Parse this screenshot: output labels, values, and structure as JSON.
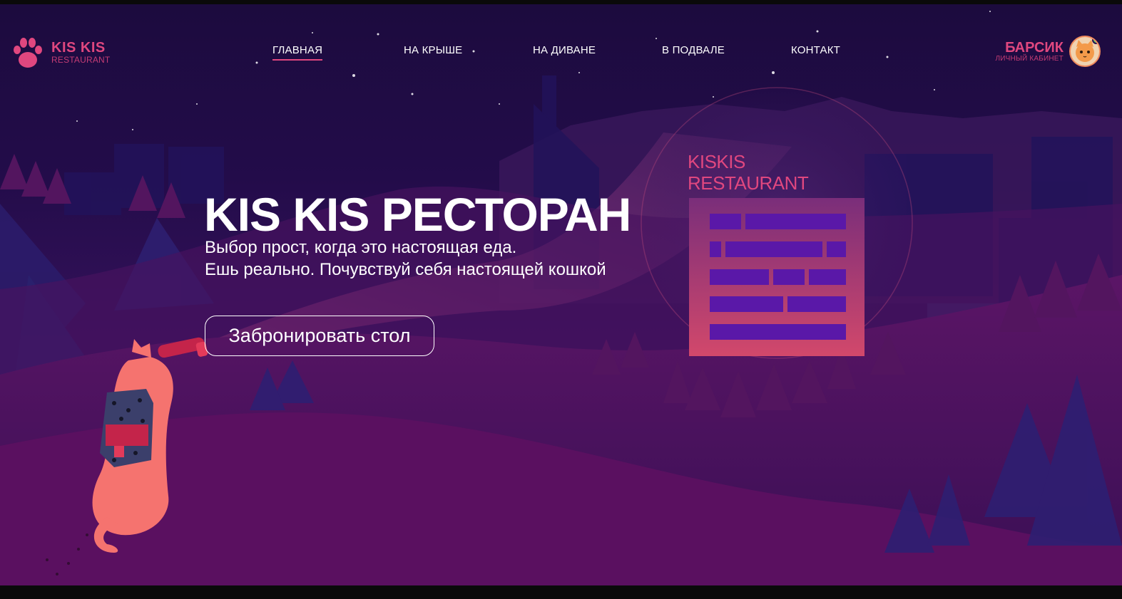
{
  "brand": {
    "name": "KIS KIS",
    "sub": "RESTAURANT"
  },
  "nav": [
    {
      "label": "ГЛАВНАЯ",
      "active": true
    },
    {
      "label": "НА  КРЫШЕ",
      "active": false
    },
    {
      "label": "НА ДИВАНЕ",
      "active": false
    },
    {
      "label": "В ПОДВАЛЕ",
      "active": false
    },
    {
      "label": "КОНТАКТ",
      "active": false
    }
  ],
  "user": {
    "name": "БАРСИК",
    "sub": "ЛИЧНЫЙ КАБИНЕТ"
  },
  "hero": {
    "title": "KIS KIS РЕСТОРАН",
    "line1": "Выбор прост, когда это настоящая еда.",
    "line2": "Ешь реально. Почувствуй себя настоящей кошкой",
    "button": "Забронировать  стол"
  },
  "circle": {
    "line1": "KISKIS",
    "line2": "RESTAURANT"
  },
  "colors": {
    "accent": "#e0477f",
    "cat": "#f5736f",
    "sky": "#1c0b3e",
    "hill": "#4a1263"
  },
  "icons": [
    "paw-icon",
    "cat-avatar-icon",
    "online-status-icon",
    "cat-illustration"
  ]
}
